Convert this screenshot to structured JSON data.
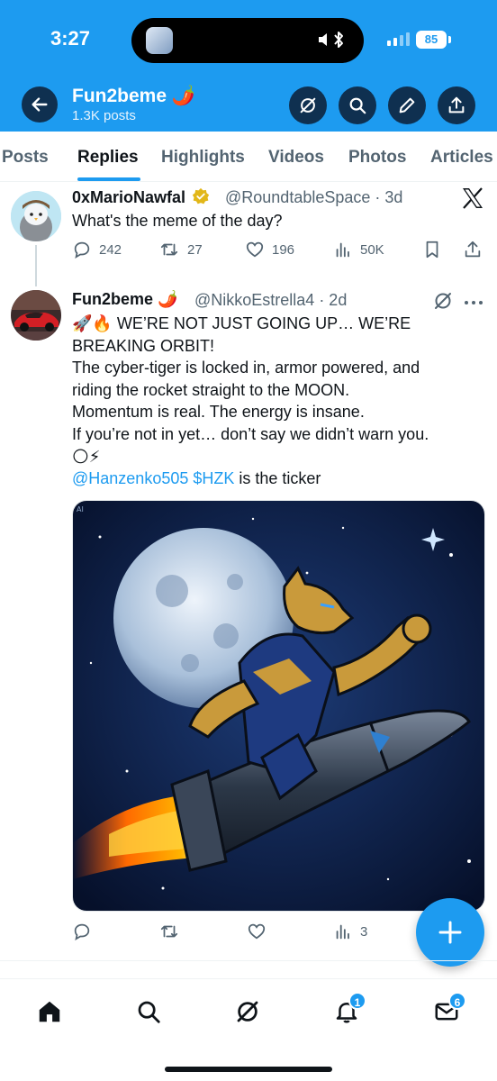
{
  "status": {
    "time": "3:27",
    "battery": "85"
  },
  "header": {
    "title": "Fun2beme 🌶️",
    "subtitle": "1.3K posts"
  },
  "tabs": [
    "Posts",
    "Replies",
    "Highlights",
    "Videos",
    "Photos",
    "Articles"
  ],
  "active_tab": "Replies",
  "parent_tweet": {
    "name": "0xMarioNawfal",
    "handle": "@RoundtableSpace · 3d",
    "text": "What's the meme of the day?",
    "replies": "242",
    "reposts": "27",
    "likes": "196",
    "views": "50K"
  },
  "reply_tweet": {
    "name": "Fun2beme 🌶️",
    "handle": "@NikkoEstrella4 · 2d",
    "lines": [
      "🚀🔥 WE’RE NOT JUST GOING UP… WE’RE",
      "BREAKING ORBIT!",
      "The cyber-tiger is locked in, armor powered, and",
      "riding the rocket straight to the MOON.",
      "Momentum is real. The energy is insane.",
      "If you’re not in yet… don’t say we didn’t warn you.",
      "🌕⚡"
    ],
    "mention": "@Hanzenko505",
    "cashtag": "$HZK",
    "ticker_text": " is the ticker",
    "views": "3"
  },
  "bottom_nav": {
    "notifications_badge": "1",
    "messages_badge": "6"
  },
  "colors": {
    "accent": "#1d9bf0",
    "header_bg": "#1d9bf0",
    "text": "#0f1419",
    "muted": "#536471"
  }
}
